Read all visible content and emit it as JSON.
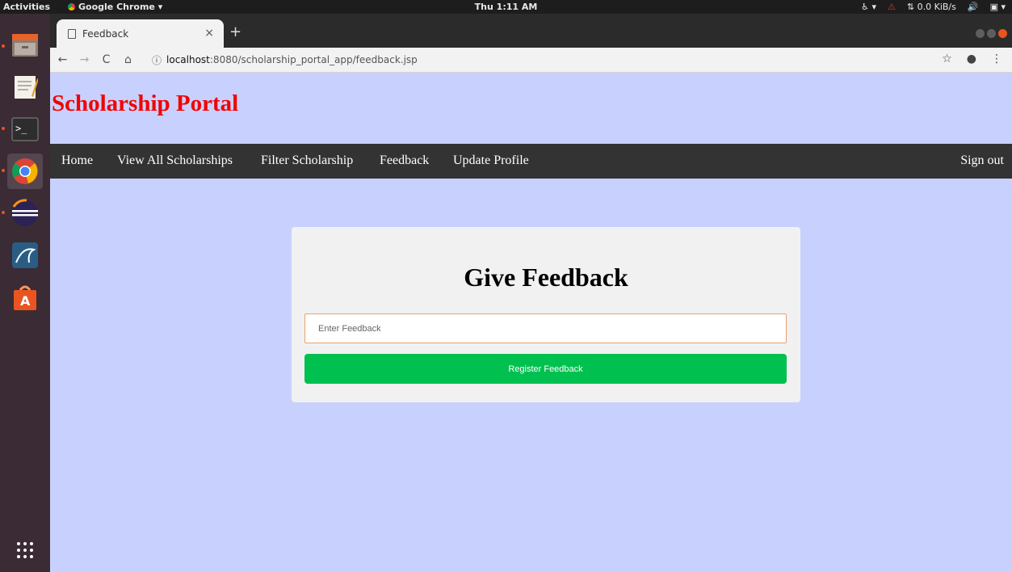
{
  "system": {
    "activities": "Activities",
    "app_name": "Google Chrome ▾",
    "clock": "Thu 1:11 AM",
    "net_speed": "0.0 KiB/s"
  },
  "browser": {
    "tab_title": "Feedback",
    "url_host": "localhost",
    "url_path": ":8080/scholarship_portal_app/feedback.jsp"
  },
  "page": {
    "brand": "Scholarship Portal",
    "nav": {
      "home": "Home",
      "view_all": "View All Scholarships",
      "filter": "Filter Scholarship",
      "feedback": "Feedback",
      "update_profile": "Update Profile",
      "sign_out": "Sign out"
    },
    "form": {
      "title": "Give Feedback",
      "placeholder": "Enter Feedback",
      "button": "Register Feedback"
    }
  },
  "colors": {
    "page_bg": "#c8d1fe",
    "brand": "#f20000",
    "navbar": "#333333",
    "button": "#00c050"
  }
}
